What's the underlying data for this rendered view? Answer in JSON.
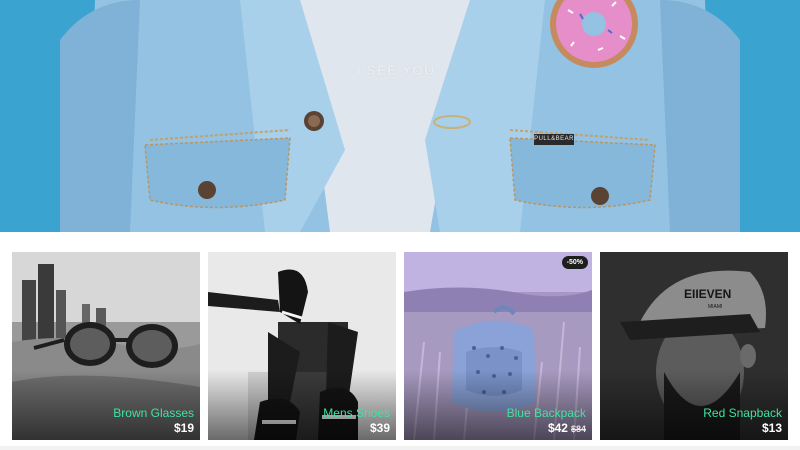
{
  "hero": {
    "shirt_text": "I SEE YOU",
    "tag_text": "PULL&BEAR",
    "colors": {
      "background": "#3aa3cf",
      "denim": "#93c2e2",
      "shirt": "#dfe6ee",
      "donut": "#e58ec9"
    }
  },
  "products": [
    {
      "name": "Brown Glasses",
      "price": "$19",
      "old_price": "",
      "badge": ""
    },
    {
      "name": "Mens Shoes",
      "price": "$39",
      "old_price": "",
      "badge": ""
    },
    {
      "name": "Blue Backpack",
      "price": "$42",
      "old_price": "$84",
      "badge": "-50%"
    },
    {
      "name": "Red Snapback",
      "price": "$13",
      "old_price": "",
      "badge": ""
    }
  ],
  "colors": {
    "accent": "#3fe3a1",
    "price": "#ffffff",
    "badge_bg": "#1d1d1d"
  }
}
